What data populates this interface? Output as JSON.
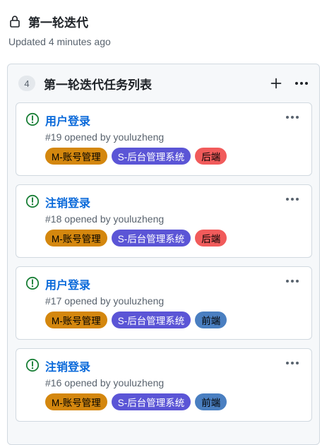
{
  "header": {
    "title": "第一轮迭代",
    "updated": "Updated 4 minutes ago"
  },
  "column": {
    "count": "4",
    "title": "第一轮迭代任务列表"
  },
  "colors": {
    "open_issue": "#1a7f37",
    "link": "#0969da",
    "label_m": "#d4870e",
    "label_s": "#5b55d6",
    "label_backend": "#f15b5b",
    "label_frontend": "#4a7fc1"
  },
  "cards": [
    {
      "title": "用户登录",
      "meta": "#19 opened by youluzheng",
      "labels": [
        {
          "text": "M-账号管理",
          "bg": "#d4870e",
          "fg": "#000000"
        },
        {
          "text": "S-后台管理系统",
          "bg": "#5b55d6",
          "fg": "#ffffff"
        },
        {
          "text": "后端",
          "bg": "#f15b5b",
          "fg": "#000000"
        }
      ]
    },
    {
      "title": "注销登录",
      "meta": "#18 opened by youluzheng",
      "labels": [
        {
          "text": "M-账号管理",
          "bg": "#d4870e",
          "fg": "#000000"
        },
        {
          "text": "S-后台管理系统",
          "bg": "#5b55d6",
          "fg": "#ffffff"
        },
        {
          "text": "后端",
          "bg": "#f15b5b",
          "fg": "#000000"
        }
      ]
    },
    {
      "title": "用户登录",
      "meta": "#17 opened by youluzheng",
      "labels": [
        {
          "text": "M-账号管理",
          "bg": "#d4870e",
          "fg": "#000000"
        },
        {
          "text": "S-后台管理系统",
          "bg": "#5b55d6",
          "fg": "#ffffff"
        },
        {
          "text": "前端",
          "bg": "#4a7fc1",
          "fg": "#000000"
        }
      ]
    },
    {
      "title": "注销登录",
      "meta": "#16 opened by youluzheng",
      "labels": [
        {
          "text": "M-账号管理",
          "bg": "#d4870e",
          "fg": "#000000"
        },
        {
          "text": "S-后台管理系统",
          "bg": "#5b55d6",
          "fg": "#ffffff"
        },
        {
          "text": "前端",
          "bg": "#4a7fc1",
          "fg": "#000000"
        }
      ]
    }
  ]
}
